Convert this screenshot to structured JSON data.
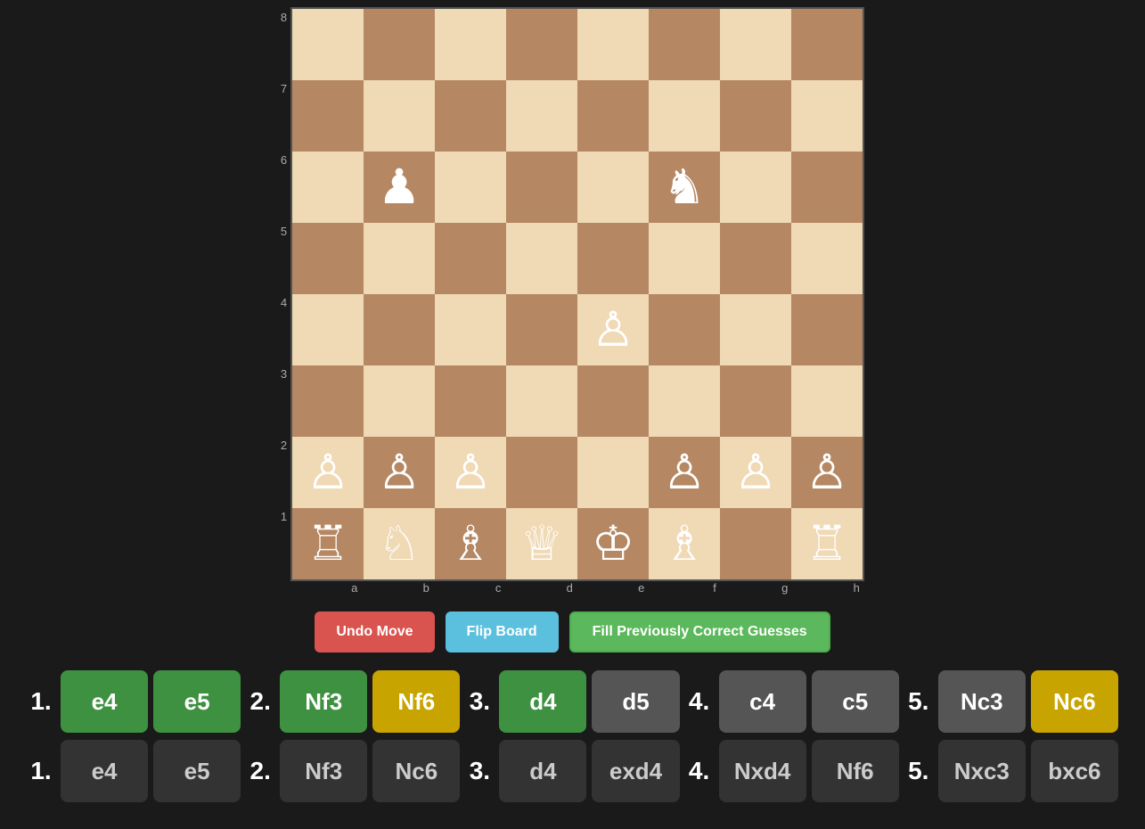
{
  "board": {
    "ranks": [
      "8",
      "7",
      "6",
      "5",
      "4",
      "3",
      "2",
      "1"
    ],
    "files": [
      "a",
      "b",
      "c",
      "d",
      "e",
      "f",
      "g",
      "h"
    ],
    "squares": [
      [
        "",
        "",
        "",
        "",
        "",
        "",
        "",
        ""
      ],
      [
        "",
        "",
        "",
        "",
        "",
        "",
        "",
        ""
      ],
      [
        "",
        "♟",
        "",
        "",
        "",
        "♞",
        "",
        ""
      ],
      [
        "",
        "",
        "",
        "",
        "",
        "",
        "",
        ""
      ],
      [
        "",
        "",
        "",
        "",
        "♙",
        "",
        "",
        ""
      ],
      [
        "",
        "",
        "",
        "",
        "",
        "",
        "",
        ""
      ],
      [
        "♙",
        "♙",
        "♙",
        "",
        "",
        "♙",
        "♙",
        "♙"
      ],
      [
        "♖",
        "♘",
        "♗",
        "♕",
        "♔",
        "♗",
        "",
        "♖"
      ]
    ],
    "rank_numbers": [
      "8",
      "7",
      "6",
      "5",
      "4",
      "3",
      "2",
      "1"
    ]
  },
  "controls": {
    "undo_label": "Undo Move",
    "flip_label": "Flip Board",
    "fill_label": "Fill Previously Correct Guesses"
  },
  "guess_row": {
    "moves": [
      {
        "number": "1.",
        "white": {
          "text": "e4",
          "style": "green"
        },
        "black": {
          "text": "e5",
          "style": "green"
        }
      },
      {
        "number": "2.",
        "white": {
          "text": "Nf3",
          "style": "green"
        },
        "black": {
          "text": "Nf6",
          "style": "yellow"
        }
      },
      {
        "number": "3.",
        "white": {
          "text": "d4",
          "style": "green"
        },
        "black": {
          "text": "d5",
          "style": "gray"
        }
      },
      {
        "number": "4.",
        "white": {
          "text": "c4",
          "style": "gray"
        },
        "black": {
          "text": "c5",
          "style": "gray"
        }
      },
      {
        "number": "5.",
        "white": {
          "text": "Nc3",
          "style": "gray"
        },
        "black": {
          "text": "Nc6",
          "style": "yellow"
        }
      }
    ]
  },
  "answer_row": {
    "moves": [
      {
        "number": "1.",
        "white": {
          "text": "e4",
          "style": "dark"
        },
        "black": {
          "text": "e5",
          "style": "dark"
        }
      },
      {
        "number": "2.",
        "white": {
          "text": "Nf3",
          "style": "dark"
        },
        "black": {
          "text": "Nc6",
          "style": "dark"
        }
      },
      {
        "number": "3.",
        "white": {
          "text": "d4",
          "style": "dark"
        },
        "black": {
          "text": "exd4",
          "style": "dark"
        }
      },
      {
        "number": "4.",
        "white": {
          "text": "Nxd4",
          "style": "dark"
        },
        "black": {
          "text": "Nf6",
          "style": "dark"
        }
      },
      {
        "number": "5.",
        "white": {
          "text": "Nxc3",
          "style": "dark"
        },
        "black": {
          "text": "bxc6",
          "style": "dark"
        }
      }
    ]
  }
}
